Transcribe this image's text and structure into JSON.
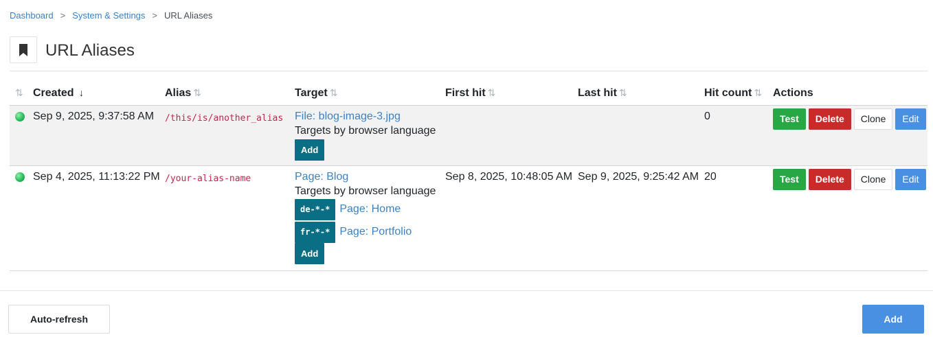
{
  "breadcrumb": {
    "items": [
      "Dashboard",
      "System & Settings"
    ],
    "separator": ">",
    "current": "URL Aliases"
  },
  "header": {
    "title": "URL Aliases",
    "icon": "bookmark-icon"
  },
  "table": {
    "columns": {
      "created": "Created",
      "created_sort": "↓",
      "alias": "Alias",
      "target": "Target",
      "first_hit": "First hit",
      "last_hit": "Last hit",
      "hit_count": "Hit count",
      "actions": "Actions"
    },
    "sort_icon": "⇅",
    "rows": [
      {
        "status_color": "#2bbd5b",
        "created": "Sep 9, 2025, 9:37:58 AM",
        "alias": "/this/is/another_alias",
        "target": "File: blog-image-3.jpg",
        "targets_label": "Targets by browser language",
        "languages": [],
        "add_label": "Add",
        "first_hit": "",
        "last_hit": "",
        "hit_count": "0",
        "actions": {
          "test": "Test",
          "delete": "Delete",
          "clone": "Clone",
          "edit": "Edit"
        }
      },
      {
        "status_color": "#2bbd5b",
        "created": "Sep 4, 2025, 11:13:22 PM",
        "alias": "/your-alias-name",
        "target": "Page: Blog",
        "targets_label": "Targets by browser language",
        "languages": [
          {
            "code": "de-*-*",
            "target": "Page: Home"
          },
          {
            "code": "fr-*-*",
            "target": "Page: Portfolio"
          }
        ],
        "add_label": "Add",
        "first_hit": "Sep 8, 2025, 10:48:05 AM",
        "last_hit": "Sep 9, 2025, 9:25:42 AM",
        "hit_count": "20",
        "actions": {
          "test": "Test",
          "delete": "Delete",
          "clone": "Clone",
          "edit": "Edit"
        }
      }
    ]
  },
  "footer": {
    "auto_refresh": "Auto-refresh",
    "add": "Add"
  },
  "colors": {
    "link": "#3b82c4",
    "teal": "#0a6f84",
    "success": "#28a745",
    "danger": "#c92a2a",
    "primary": "#4a90e2"
  }
}
